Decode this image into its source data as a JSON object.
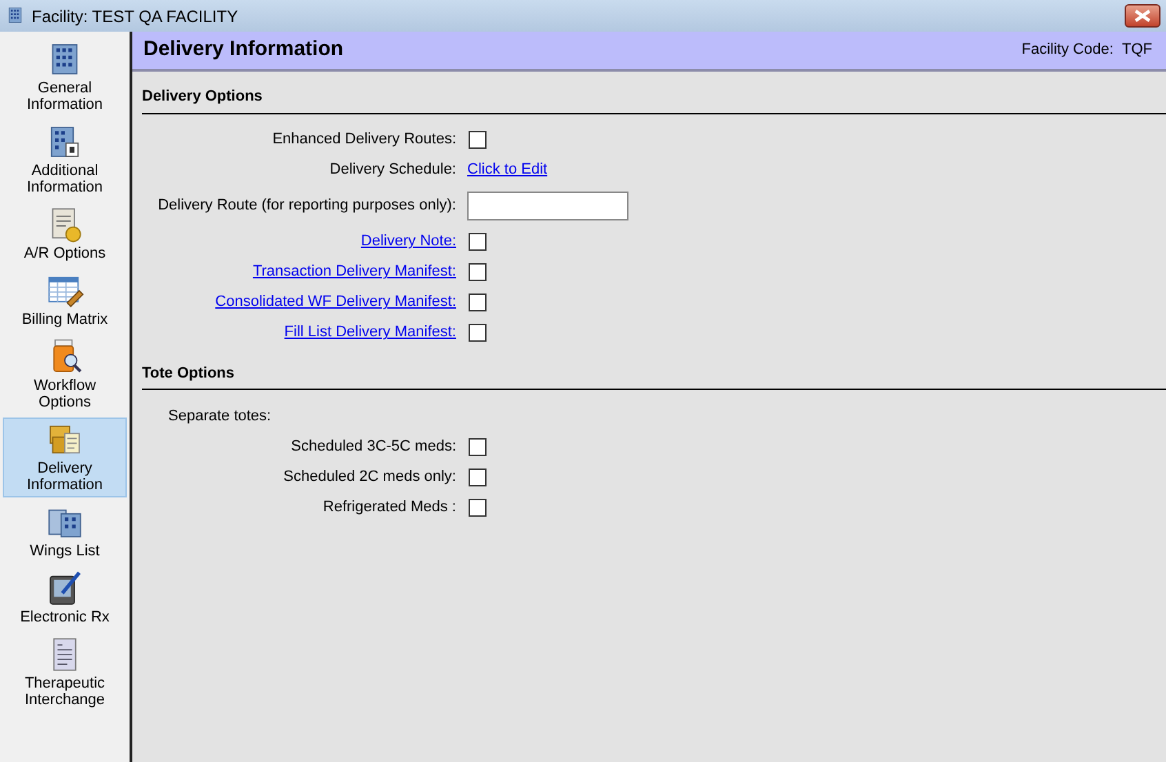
{
  "window": {
    "title": "Facility: TEST QA FACILITY"
  },
  "sidebar": {
    "items": [
      {
        "label": "General Information",
        "selected": false
      },
      {
        "label": "Additional Information",
        "selected": false
      },
      {
        "label": "A/R Options",
        "selected": false
      },
      {
        "label": "Billing Matrix",
        "selected": false
      },
      {
        "label": "Workflow Options",
        "selected": false
      },
      {
        "label": "Delivery Information",
        "selected": true
      },
      {
        "label": "Wings List",
        "selected": false
      },
      {
        "label": "Electronic Rx",
        "selected": false
      },
      {
        "label": "Therapeutic Interchange",
        "selected": false
      }
    ]
  },
  "header": {
    "title": "Delivery Information",
    "code_label": "Facility Code:",
    "code_value": "TQF"
  },
  "sections": [
    {
      "title": "Delivery Options",
      "rows": [
        {
          "kind": "checkbox",
          "label": "Enhanced Delivery Routes:",
          "linked": false,
          "checked": false
        },
        {
          "kind": "link",
          "label": "Delivery Schedule:",
          "linked": false,
          "value": "Click to Edit"
        },
        {
          "kind": "textbox",
          "label": "Delivery Route (for reporting purposes only):",
          "linked": false
        },
        {
          "kind": "checkbox",
          "label": "Delivery Note:",
          "linked": true,
          "checked": false
        },
        {
          "kind": "checkbox",
          "label": "Transaction Delivery Manifest:",
          "linked": true,
          "checked": false
        },
        {
          "kind": "checkbox",
          "label": "Consolidated WF Delivery Manifest:",
          "linked": true,
          "checked": false
        },
        {
          "kind": "checkbox",
          "label": "Fill List Delivery Manifest:",
          "linked": true,
          "checked": false
        }
      ]
    },
    {
      "title": "Tote Options",
      "rows": [
        {
          "kind": "note",
          "label": "Separate totes:"
        },
        {
          "kind": "checkbox",
          "label": "Scheduled 3C-5C meds:",
          "linked": false,
          "checked": false
        },
        {
          "kind": "checkbox",
          "label": "Scheduled 2C meds only:",
          "linked": false,
          "checked": false
        },
        {
          "kind": "checkbox",
          "label": "Refrigerated Meds :",
          "linked": false,
          "checked": false
        }
      ]
    }
  ]
}
